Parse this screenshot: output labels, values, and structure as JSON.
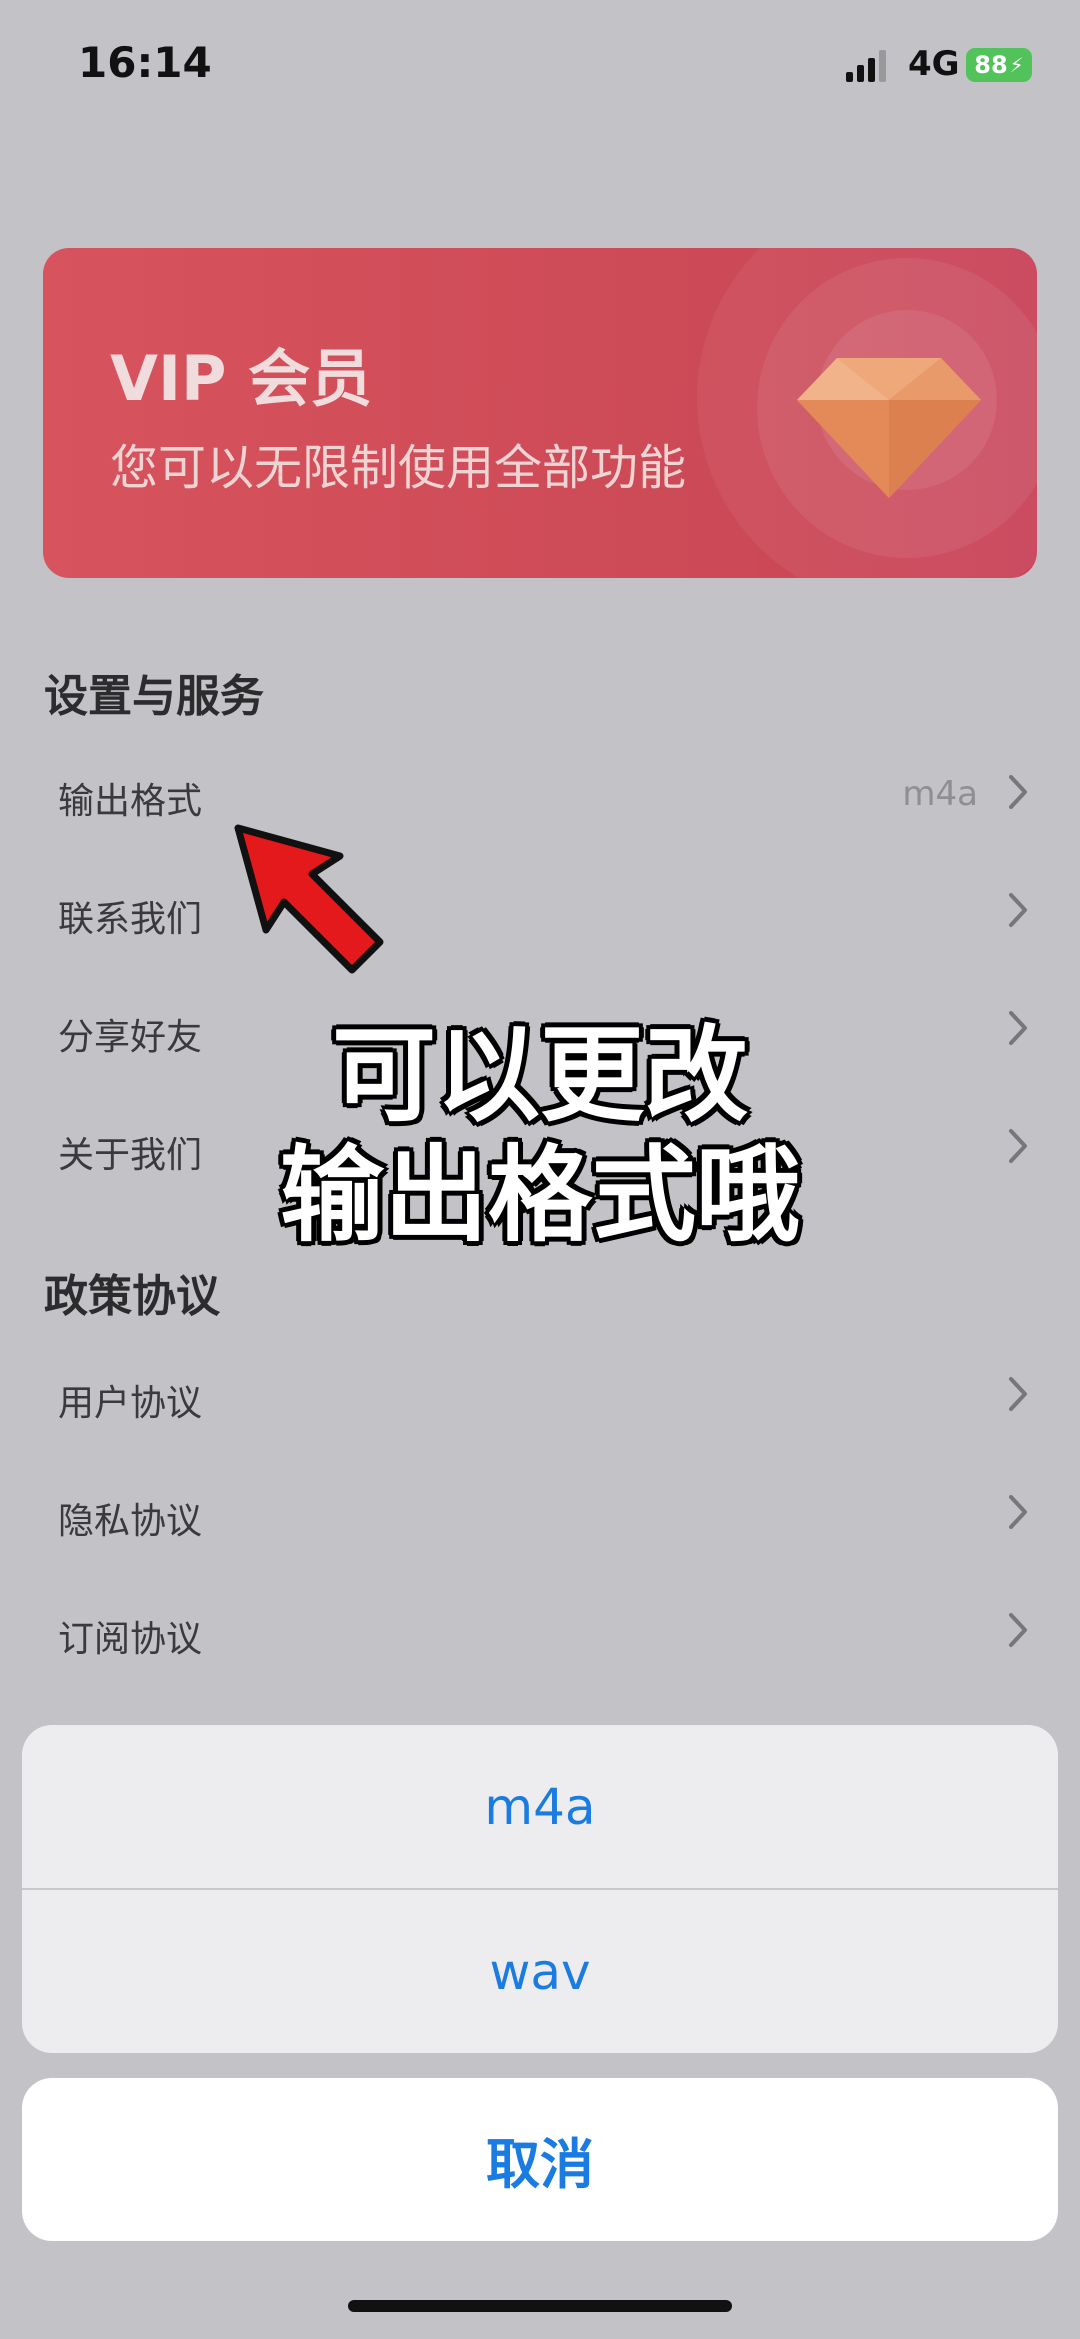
{
  "status_bar": {
    "time": "16:14",
    "network": "4G",
    "battery": "88"
  },
  "vip": {
    "title": "VIP 会员",
    "subtitle": "您可以无限制使用全部功能"
  },
  "sections": {
    "settings_title": "设置与服务",
    "settings_items": [
      {
        "label": "输出格式",
        "value": "m4a"
      },
      {
        "label": "联系我们"
      },
      {
        "label": "分享好友"
      },
      {
        "label": "关于我们"
      }
    ],
    "policy_title": "政策协议",
    "policy_items": [
      {
        "label": "用户协议"
      },
      {
        "label": "隐私协议"
      },
      {
        "label": "订阅协议"
      }
    ]
  },
  "overlay_caption": {
    "line1": "可以更改",
    "line2": "输出格式哦"
  },
  "action_sheet": {
    "options": [
      "m4a",
      "wav"
    ],
    "cancel": "取消"
  },
  "colors": {
    "accent": "#1a7be0",
    "vip_card": "#d04d58",
    "battery": "#52c25a",
    "dim_background": "#c3c3c7"
  },
  "icons": [
    "signal-icon",
    "battery-icon",
    "diamond-icon",
    "chevron-right-icon",
    "red-arrow-annotation"
  ]
}
